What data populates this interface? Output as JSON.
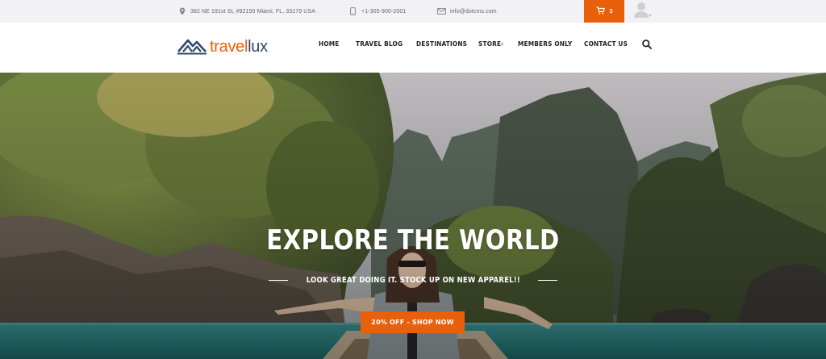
{
  "topbar": {
    "address": "382 NE 191st St, #92150 Miami, FL, 33179 USA",
    "phone": "+1-305-900-2001",
    "email": "info@dotcms.com",
    "cart_count": "3",
    "icons": {
      "address": "map-pin-icon",
      "phone": "mobile-phone-icon",
      "email": "envelope-icon",
      "cart": "shopping-cart-icon",
      "user": "user-avatar-icon"
    }
  },
  "brand": {
    "logo_part1": "travel",
    "logo_part2": "lux",
    "colors": {
      "orange": "#e8600c",
      "navy": "#2d4a6b"
    }
  },
  "nav": {
    "items": [
      "HOME",
      "TRAVEL BLOG",
      "DESTINATIONS",
      "STORE",
      "MEMBERS ONLY",
      "CONTACT US"
    ],
    "store_arrow": "›"
  },
  "hero": {
    "title": "EXPLORE THE WORLD",
    "subtitle": "LOOK GREAT DOING IT. STOCK UP ON NEW APPAREL!!",
    "button": "20% OFF - SHOP NOW"
  }
}
